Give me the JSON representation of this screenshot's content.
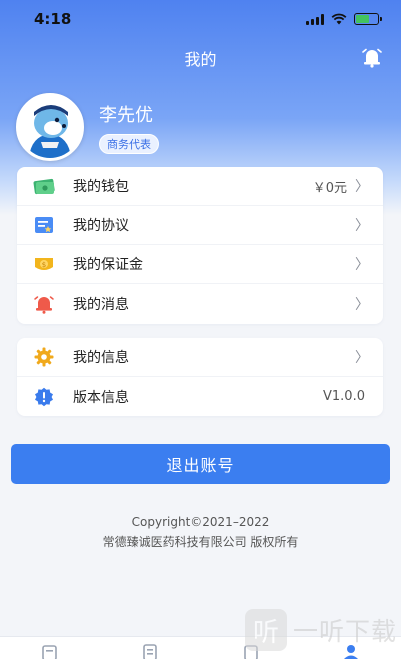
{
  "status_bar": {
    "time": "4:18"
  },
  "header": {
    "title": "我的"
  },
  "profile": {
    "name": "李先优",
    "role": "商务代表"
  },
  "menu_primary": [
    {
      "label": "我的钱包",
      "value": "￥0元",
      "icon": "wallet-icon"
    },
    {
      "label": "我的协议",
      "value": "",
      "icon": "agreement-icon"
    },
    {
      "label": "我的保证金",
      "value": "",
      "icon": "deposit-icon"
    },
    {
      "label": "我的消息",
      "value": "",
      "icon": "message-bell-icon"
    }
  ],
  "menu_secondary": [
    {
      "label": "我的信息",
      "icon": "gear-icon"
    },
    {
      "label": "版本信息",
      "value": "V1.0.0",
      "icon": "info-badge-icon"
    }
  ],
  "logout": {
    "label": "退出账号"
  },
  "footer": {
    "copyright": "Copyright©2021–2022",
    "company": "常德臻诚医药科技有限公司  版权所有"
  },
  "watermark": {
    "text": "一听下载",
    "mark": "听"
  },
  "colors": {
    "primary": "#3b7ef0",
    "header_top": "#4f82f0"
  }
}
